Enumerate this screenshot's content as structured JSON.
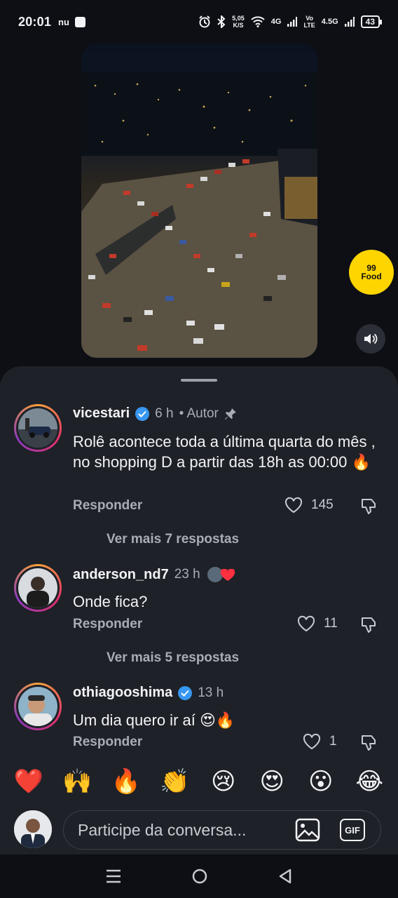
{
  "status_bar": {
    "time": "20:01",
    "carrier_icon": "nu",
    "speed_value": "5,05",
    "speed_unit": "K/S",
    "net1": "4G",
    "net2_top": "Vo",
    "net2_bottom": "LTE",
    "net3": "4.5G",
    "battery": "43"
  },
  "video": {
    "brand_badge_line1": "99",
    "brand_badge_line2": "Food",
    "volume_icon": "speaker-icon"
  },
  "comments": [
    {
      "username": "vicestari",
      "verified": true,
      "time": "6 h",
      "author_label": "• Autor",
      "pinned": true,
      "text": "Rolê acontece toda a última quarta do mês , no shopping D a partir das 18h as 00:00 🔥",
      "reply_label": "Responder",
      "likes": "145",
      "more_replies": "Ver mais 7 respostas"
    },
    {
      "username": "anderson_nd7",
      "verified": false,
      "time": "23 h",
      "text": "Onde fica?",
      "reply_label": "Responder",
      "likes": "11",
      "more_replies": "Ver mais 5 respostas"
    },
    {
      "username": "othiagooshima",
      "verified": true,
      "time": "13 h",
      "text": "Um dia quero ir aí 😍🔥",
      "reply_label": "Responder",
      "likes": "1"
    }
  ],
  "reactions": [
    "❤️",
    "🙌",
    "🔥",
    "👏",
    "😢",
    "😍",
    "😮",
    "😂"
  ],
  "composer": {
    "placeholder": "Participe da conversa...",
    "gif_label": "GIF"
  },
  "colors": {
    "background": "#0d0f14",
    "sheet": "#1e2127",
    "verified": "#3897f0",
    "brand_yellow": "#ffd500",
    "text_secondary": "#a8adb5"
  }
}
